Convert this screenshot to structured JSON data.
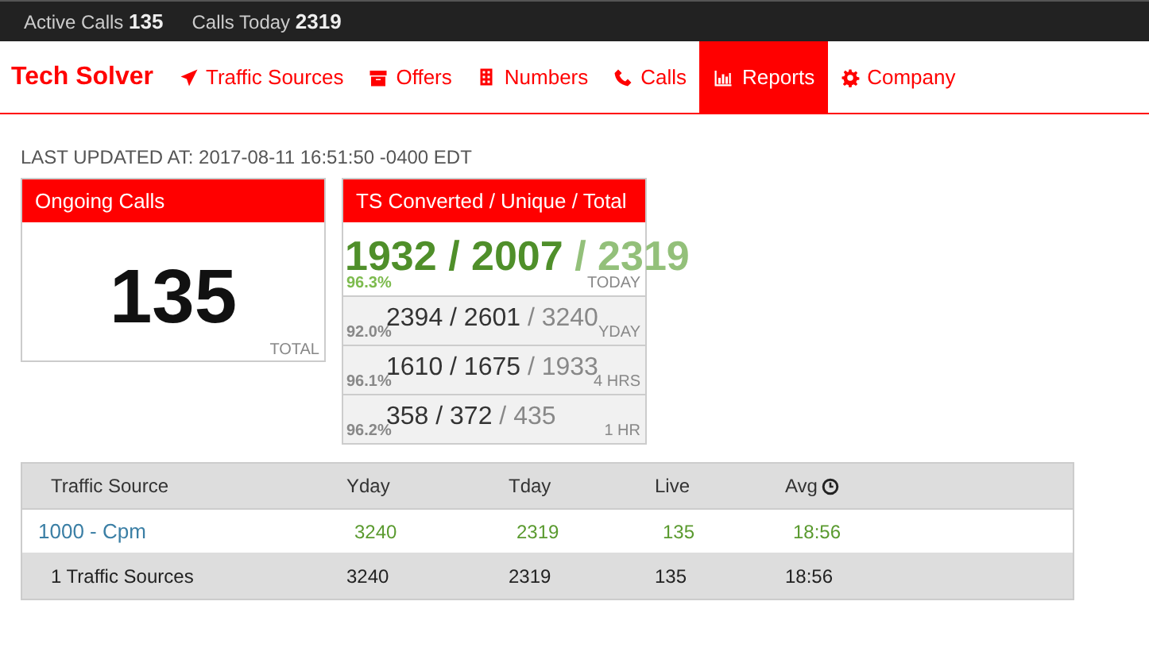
{
  "top_bar": {
    "stats": [
      {
        "label": "Active Calls",
        "value": "135"
      },
      {
        "label": "Calls Today",
        "value": "2319"
      }
    ]
  },
  "nav": {
    "brand": "Tech Solver",
    "items": [
      {
        "label": "Traffic Sources",
        "selected": false
      },
      {
        "label": "Offers",
        "selected": false
      },
      {
        "label": "Numbers",
        "selected": false
      },
      {
        "label": "Calls",
        "selected": false
      },
      {
        "label": "Reports",
        "selected": true
      },
      {
        "label": "Company",
        "selected": false
      }
    ]
  },
  "last_updated": "LAST UPDATED AT: 2017-08-11 16:51:50 -0400 EDT",
  "ongoing": {
    "title": "Ongoing Calls",
    "value": "135",
    "caption": "TOTAL"
  },
  "ts": {
    "title": "TS Converted / Unique / Total",
    "rows": [
      {
        "kind": "highlight",
        "percent": "96.3%",
        "main": "1932 / 2007",
        "total": "/ 2319",
        "period": "TODAY"
      },
      {
        "kind": "normal",
        "percent": "92.0%",
        "main": "2394 / 2601",
        "total": "/ 3240",
        "period": "YDAY"
      },
      {
        "kind": "normal",
        "percent": "96.1%",
        "main": "1610 / 1675",
        "total": "/ 1933",
        "period": "4 HRS"
      },
      {
        "kind": "normal",
        "percent": "96.2%",
        "main": "358 / 372",
        "total": "/ 435",
        "period": "1 HR"
      }
    ]
  },
  "table": {
    "columns": [
      "Traffic Source",
      "Yday",
      "Tday",
      "Live",
      "Avg"
    ],
    "rows": [
      {
        "kind": "source",
        "cells": [
          "1000 - Cpm",
          "3240",
          "2319",
          "135",
          "18:56"
        ]
      },
      {
        "kind": "summary",
        "cells": [
          "1 Traffic Sources",
          "3240",
          "2319",
          "135",
          "18:56"
        ]
      }
    ]
  }
}
